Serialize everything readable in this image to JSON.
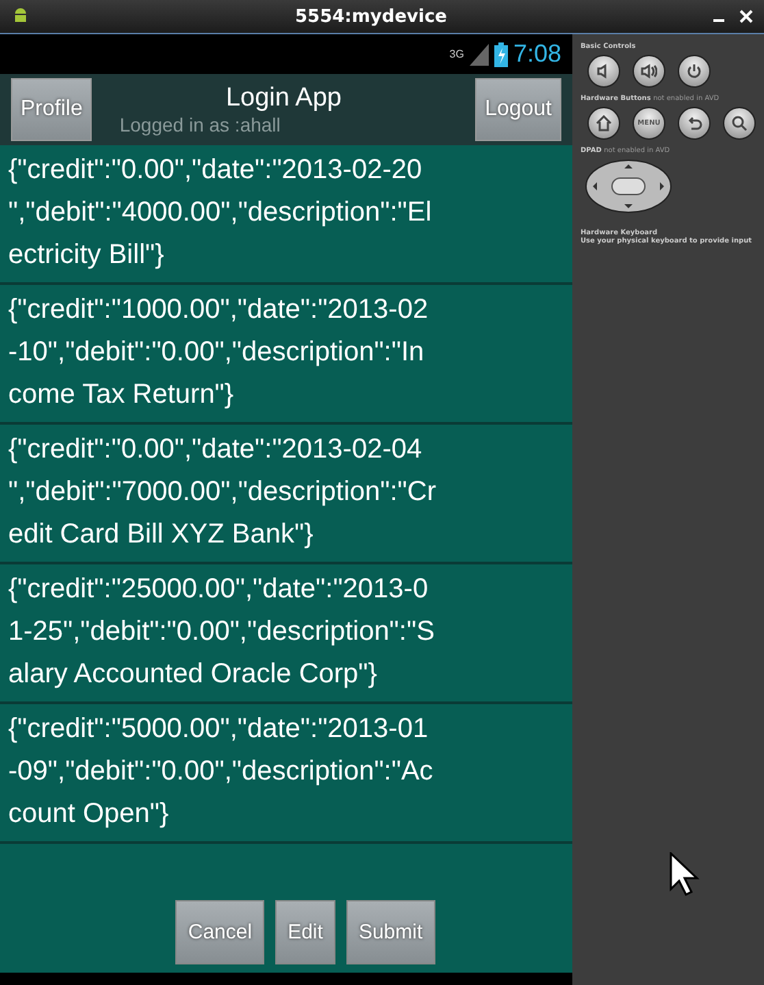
{
  "window": {
    "title": "5554:mydevice"
  },
  "status_bar": {
    "network": "3G",
    "time": "7:08"
  },
  "header": {
    "left_button": "Profile",
    "title": "Login App",
    "subtitle": "Logged in as :ahall",
    "right_button": "Logout"
  },
  "records": [
    {
      "lines": [
        "{\"credit\":\"0.00\",\"date\":\"2013-02-20",
        "\",\"debit\":\"4000.00\",\"description\":\"El",
        "ectricity Bill\"}"
      ]
    },
    {
      "lines": [
        "{\"credit\":\"1000.00\",\"date\":\"2013-02",
        "-10\",\"debit\":\"0.00\",\"description\":\"In",
        "come Tax Return\"}"
      ]
    },
    {
      "lines": [
        "{\"credit\":\"0.00\",\"date\":\"2013-02-04",
        "\",\"debit\":\"7000.00\",\"description\":\"Cr",
        "edit Card Bill XYZ Bank\"}"
      ]
    },
    {
      "lines": [
        "{\"credit\":\"25000.00\",\"date\":\"2013-0",
        "1-25\",\"debit\":\"0.00\",\"description\":\"S",
        "alary Accounted Oracle Corp\"}"
      ]
    },
    {
      "lines": [
        "{\"credit\":\"5000.00\",\"date\":\"2013-01",
        "-09\",\"debit\":\"0.00\",\"description\":\"Ac",
        "count Open\"}"
      ]
    }
  ],
  "buttons": [
    "Cancel",
    "Edit",
    "Submit"
  ],
  "controls": {
    "basic_label": "Basic Controls",
    "hardware_label": "Hardware Buttons",
    "hardware_note": "not enabled in AVD",
    "menu_key": "MENU",
    "dpad_label": "DPAD",
    "dpad_note": "not enabled in AVD",
    "keyboard_label": "Hardware Keyboard",
    "keyboard_note": "Use your physical keyboard to provide input"
  }
}
